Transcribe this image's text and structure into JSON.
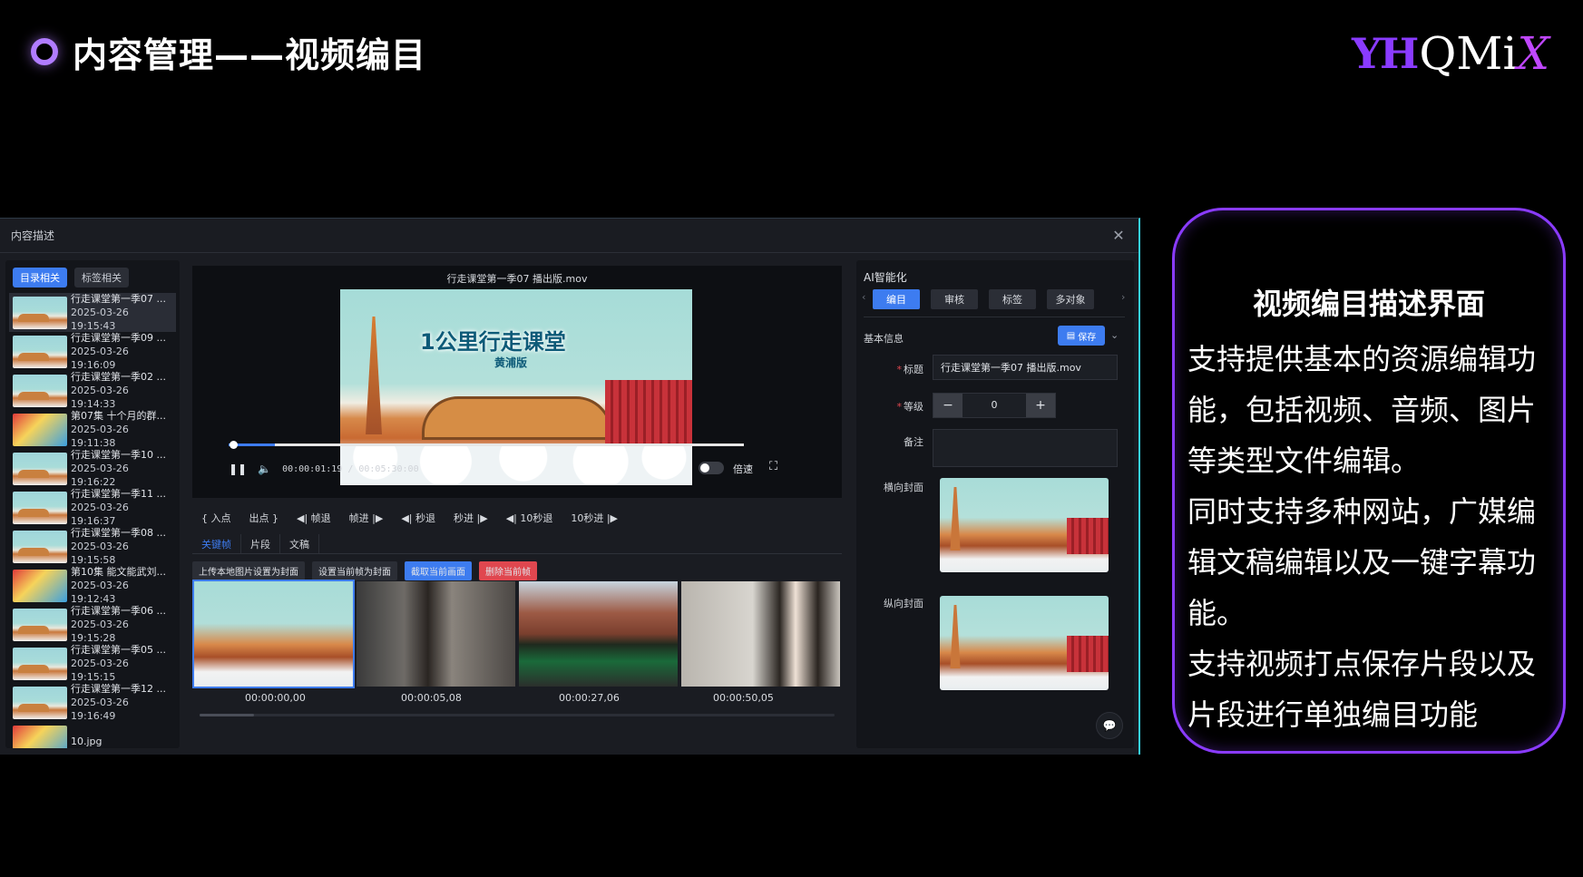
{
  "slide": {
    "title": "内容管理——视频编目",
    "logo_mark": "YH",
    "logo_text": "QMi",
    "logo_x": "X"
  },
  "window": {
    "title": "内容描述",
    "close_icon": "close-icon"
  },
  "left_panel": {
    "tabs": [
      {
        "label": "目录相关",
        "active": true
      },
      {
        "label": "标签相关",
        "active": false
      }
    ],
    "items": [
      {
        "name": "行走课堂第一季07 ...",
        "date": "2025-03-26 19:15:43",
        "selected": true,
        "thumb": "video"
      },
      {
        "name": "行走课堂第一季09 ...",
        "date": "2025-03-26 19:16:09",
        "selected": false,
        "thumb": "video"
      },
      {
        "name": "行走课堂第一季02 ...",
        "date": "2025-03-26 19:14:33",
        "selected": false,
        "thumb": "video"
      },
      {
        "name": "第07集 十个月的群...",
        "date": "2025-03-26 19:11:38",
        "selected": false,
        "thumb": "poster"
      },
      {
        "name": "行走课堂第一季10 ...",
        "date": "2025-03-26 19:16:22",
        "selected": false,
        "thumb": "video"
      },
      {
        "name": "行走课堂第一季11 ...",
        "date": "2025-03-26 19:16:37",
        "selected": false,
        "thumb": "video"
      },
      {
        "name": "行走课堂第一季08 ...",
        "date": "2025-03-26 19:15:58",
        "selected": false,
        "thumb": "video"
      },
      {
        "name": "第10集 能文能武刘...",
        "date": "2025-03-26 19:12:43",
        "selected": false,
        "thumb": "poster"
      },
      {
        "name": "行走课堂第一季06 ...",
        "date": "2025-03-26 19:15:28",
        "selected": false,
        "thumb": "video"
      },
      {
        "name": "行走课堂第一季05 ...",
        "date": "2025-03-26 19:15:15",
        "selected": false,
        "thumb": "video"
      },
      {
        "name": "行走课堂第一季12 ...",
        "date": "2025-03-26 19:16:49",
        "selected": false,
        "thumb": "video"
      },
      {
        "name": "10.jpg",
        "date": "",
        "selected": false,
        "thumb": "poster"
      }
    ]
  },
  "player": {
    "file_name": "行走课堂第一季07 播出版.mov",
    "video_art_title": "1公里行走课堂",
    "video_art_sub": "黄浦版",
    "current_time": "00:00:01:19",
    "total_time": "00:05:30:00",
    "time_separator": " / ",
    "progress": 0.0096,
    "buffered": 0.09,
    "play_icon": "pause-icon",
    "volume_icon": "volume-icon",
    "speed_label": "倍速",
    "fullscreen_icon": "fullscreen-icon"
  },
  "mark_buttons": [
    {
      "label": "{ 入点"
    },
    {
      "label": "出点 }"
    },
    {
      "label": "◀| 帧退"
    },
    {
      "label": "帧进 |▶"
    },
    {
      "label": "◀| 秒退"
    },
    {
      "label": "秒进 |▶"
    },
    {
      "label": "◀| 10秒退"
    },
    {
      "label": "10秒进 |▶"
    }
  ],
  "sub_tabs": [
    {
      "label": "关键帧",
      "active": true
    },
    {
      "label": "片段",
      "active": false
    },
    {
      "label": "文稿",
      "active": false
    }
  ],
  "actions": [
    {
      "label": "上传本地图片设置为封面",
      "style": "default"
    },
    {
      "label": "设置当前帧为封面",
      "style": "default"
    },
    {
      "label": "截取当前画面",
      "style": "blue"
    },
    {
      "label": "删除当前帧",
      "style": "red"
    }
  ],
  "keyframes": [
    {
      "time": "00:00:00,00",
      "selected": true
    },
    {
      "time": "00:00:05,08",
      "selected": false
    },
    {
      "time": "00:00:27,06",
      "selected": false
    },
    {
      "time": "00:00:50,05",
      "selected": false
    }
  ],
  "right_panel": {
    "title": "AI智能化",
    "tabs": [
      {
        "label": "编目",
        "active": true
      },
      {
        "label": "审核",
        "active": false
      },
      {
        "label": "标签",
        "active": false
      },
      {
        "label": "多对象",
        "active": false
      }
    ],
    "basic_info_label": "基本信息",
    "save_label": "保存",
    "fields": {
      "title_label": "标题",
      "title_value": "行走课堂第一季07 播出版.mov",
      "level_label": "等级",
      "level_value": "0",
      "note_label": "备注",
      "note_value": "",
      "cover_h_label": "横向封面",
      "cover_v_label": "纵向封面"
    }
  },
  "description": {
    "heading": "视频编目描述界面",
    "paragraphs": [
      "支持提供基本的资源编辑功能，包括视频、音频、图片等类型文件编辑。",
      "同时支持多种网站，广媒编辑文稿编辑以及一键字幕功能。",
      "支持视频打点保存片段以及片段进行单独编目功能"
    ]
  },
  "colors": {
    "accent": "#3d7cf0",
    "brand_purple": "#8a3bff",
    "danger": "#e0474f",
    "window_edge": "#35d2e6"
  }
}
